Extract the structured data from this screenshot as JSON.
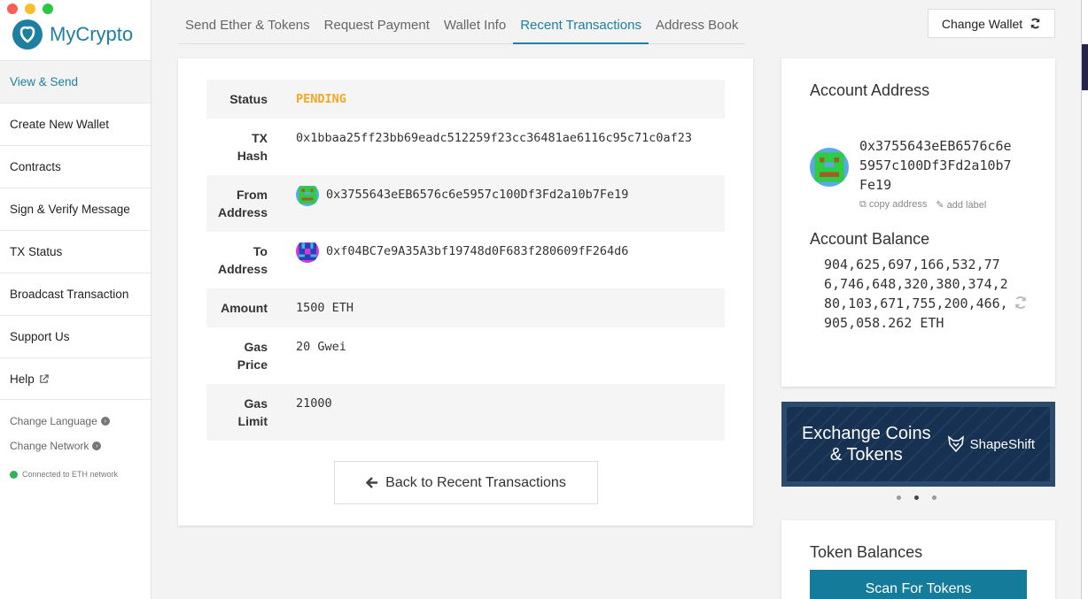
{
  "app": {
    "name": "MyCrypto"
  },
  "sidebar": {
    "items": [
      {
        "label": "View & Send",
        "active": true
      },
      {
        "label": "Create New Wallet"
      },
      {
        "label": "Contracts"
      },
      {
        "label": "Sign & Verify Message"
      },
      {
        "label": "TX Status"
      },
      {
        "label": "Broadcast Transaction"
      },
      {
        "label": "Support Us"
      },
      {
        "label": "Help"
      }
    ],
    "change_language": "Change Language",
    "change_network": "Change Network",
    "network_status": "Connected to ETH network"
  },
  "tabs": [
    {
      "label": "Send Ether & Tokens"
    },
    {
      "label": "Request Payment"
    },
    {
      "label": "Wallet Info"
    },
    {
      "label": "Recent Transactions",
      "active": true
    },
    {
      "label": "Address Book"
    }
  ],
  "header": {
    "change_wallet": "Change Wallet"
  },
  "transaction": {
    "status_label": "Status",
    "status_value": "PENDING",
    "hash_label": "TX Hash",
    "hash_value": "0x1bbaa25ff23bb69eadc512259f23cc36481ae6116c95c71c0af23",
    "from_label": "From Address",
    "from_value": "0x3755643eEB6576c6e5957c100Df3Fd2a10b7Fe19",
    "to_label": "To Address",
    "to_value": "0xf04BC7e9A35A3bf19748d0F683f280609fF264d6",
    "amount_label": "Amount",
    "amount_value": "1500 ETH",
    "gas_price_label": "Gas Price",
    "gas_price_value": "20 Gwei",
    "gas_limit_label": "Gas Limit",
    "gas_limit_value": "21000",
    "back_button": "Back to Recent Transactions"
  },
  "account": {
    "title": "Account Address",
    "address": "0x3755643eEB6576c6e5957c100Df3Fd2a10b7Fe19",
    "copy_label": "copy address",
    "add_label": "add label",
    "balance_title": "Account Balance",
    "balance_value": "904,625,697,166,532,776,746,648,320,380,374,280,103,671,755,200,466,905,058.262 ETH"
  },
  "promo": {
    "text_line1": "Exchange Coins",
    "text_line2": "& Tokens",
    "brand": "ShapeShift"
  },
  "tokens": {
    "title": "Token Balances",
    "scan_button": "Scan For Tokens"
  },
  "colors": {
    "accent": "#1e7fa1",
    "pending": "#f5a623",
    "connected": "#2fb556",
    "scan_button": "#157b9b",
    "promo_bg": "#163151"
  }
}
